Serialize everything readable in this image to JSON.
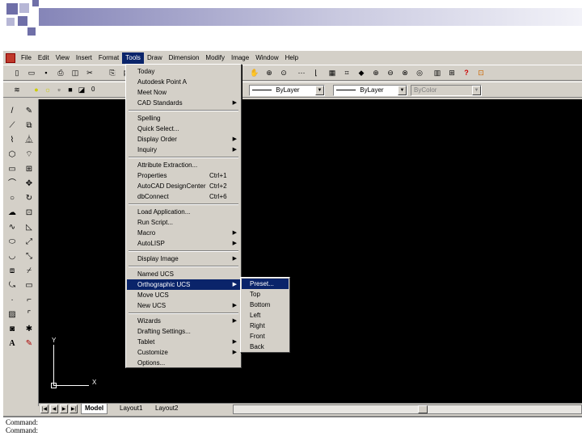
{
  "menubar": {
    "items": [
      "File",
      "Edit",
      "View",
      "Insert",
      "Format",
      "Tools",
      "Draw",
      "Dimension",
      "Modify",
      "Image",
      "Window",
      "Help"
    ],
    "active": "Tools"
  },
  "layer_toolbar": {
    "layer_value": "0",
    "color_value": "ByLayer",
    "linetype_value": "ByLayer",
    "lineweight_value": "ByColor"
  },
  "tools_menu": {
    "items": [
      {
        "label": "Today"
      },
      {
        "label": "Autodesk Point A"
      },
      {
        "label": "Meet Now"
      },
      {
        "label": "CAD Standards",
        "submenu": true
      },
      {
        "separator": true
      },
      {
        "label": "Spelling"
      },
      {
        "label": "Quick Select..."
      },
      {
        "label": "Display Order",
        "submenu": true
      },
      {
        "label": "Inquiry",
        "submenu": true
      },
      {
        "separator": true
      },
      {
        "label": "Attribute Extraction..."
      },
      {
        "label": "Properties",
        "shortcut": "Ctrl+1"
      },
      {
        "label": "AutoCAD DesignCenter",
        "shortcut": "Ctrl+2"
      },
      {
        "label": "dbConnect",
        "shortcut": "Ctrl+6"
      },
      {
        "separator": true
      },
      {
        "label": "Load Application..."
      },
      {
        "label": "Run Script..."
      },
      {
        "label": "Macro",
        "submenu": true
      },
      {
        "label": "AutoLISP",
        "submenu": true
      },
      {
        "separator": true
      },
      {
        "label": "Display Image",
        "submenu": true
      },
      {
        "separator": true
      },
      {
        "label": "Named UCS"
      },
      {
        "label": "Orthographic UCS",
        "submenu": true,
        "active": true
      },
      {
        "label": "Move UCS"
      },
      {
        "label": "New UCS",
        "submenu": true
      },
      {
        "separator": true
      },
      {
        "label": "Wizards",
        "submenu": true
      },
      {
        "label": "Drafting Settings..."
      },
      {
        "label": "Tablet",
        "submenu": true
      },
      {
        "label": "Customize",
        "submenu": true
      },
      {
        "label": "Options..."
      }
    ]
  },
  "ortho_submenu": {
    "items": [
      {
        "label": "Preset...",
        "active": true
      },
      {
        "label": "Top"
      },
      {
        "label": "Bottom"
      },
      {
        "label": "Left"
      },
      {
        "label": "Right"
      },
      {
        "label": "Front"
      },
      {
        "label": "Back"
      }
    ]
  },
  "ucs": {
    "x_label": "X",
    "y_label": "Y"
  },
  "tabs": {
    "items": [
      "Model",
      "Layout1",
      "Layout2"
    ],
    "active": "Model"
  },
  "command": {
    "lines": [
      "Command:",
      "Command:"
    ]
  },
  "colors": {
    "menu_highlight": "#0a246a",
    "chrome": "#d4d0c8",
    "canvas": "#000000"
  }
}
